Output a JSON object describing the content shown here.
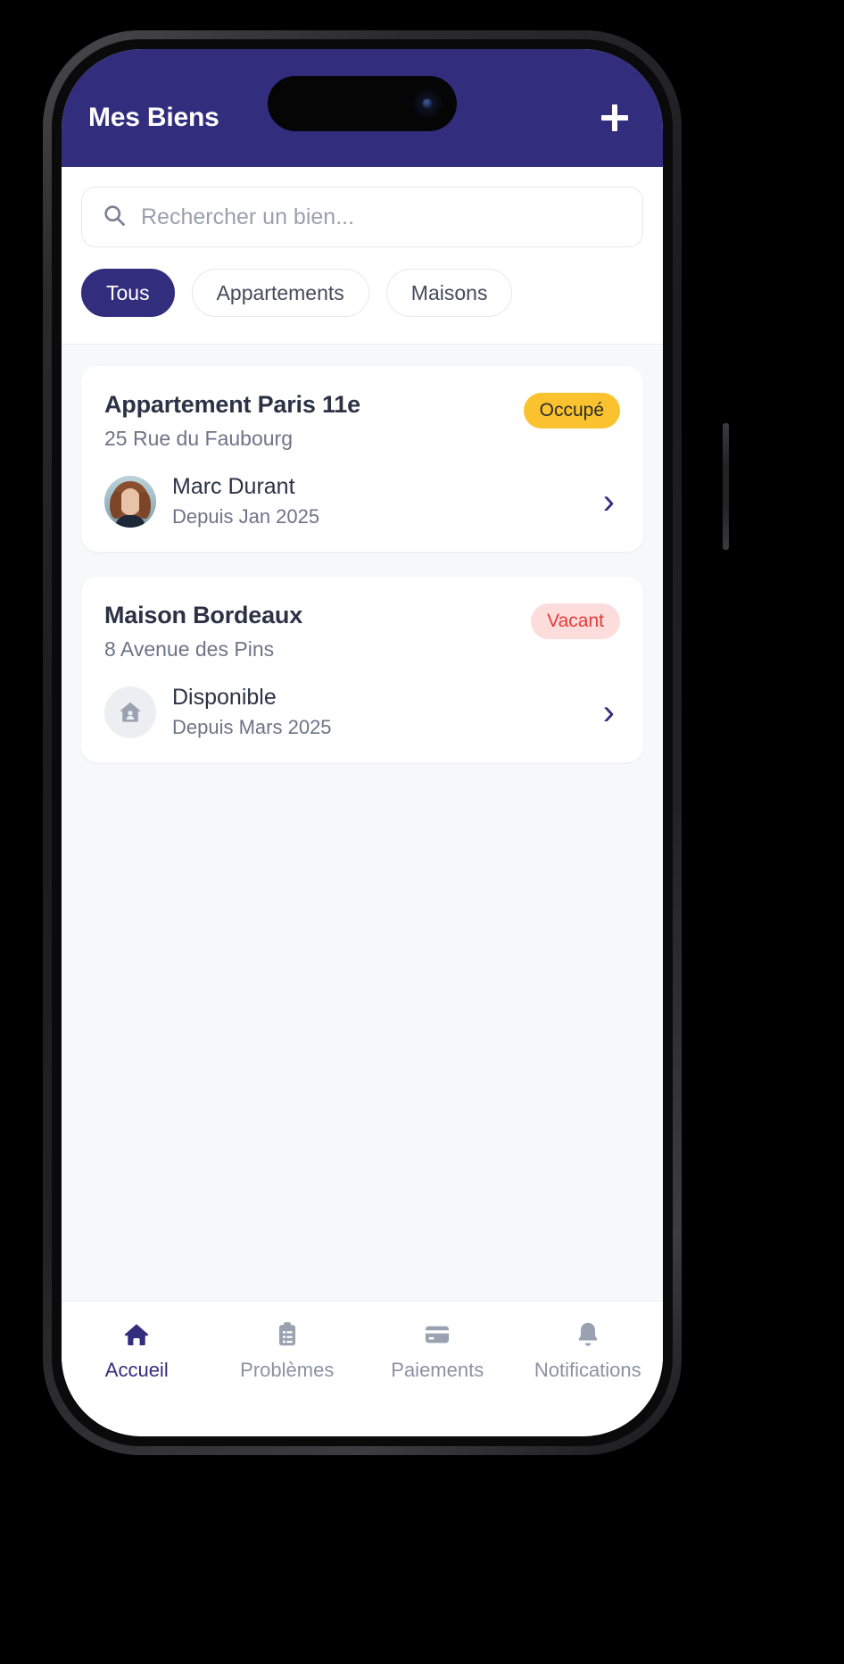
{
  "app": {
    "header": {
      "title": "Mes Biens",
      "add_button_label": "+",
      "add_icon": "plus-icon",
      "background_color": "#332D7E"
    },
    "search": {
      "icon": "search-icon",
      "placeholder": "Rechercher un bien...",
      "value": ""
    },
    "filters": [
      {
        "label": "Tous",
        "active": true
      },
      {
        "label": "Appartements",
        "active": false
      },
      {
        "label": "Maisons",
        "active": false
      }
    ],
    "properties": [
      {
        "title": "Appartement Paris 11e",
        "address": "25 Rue du Faubourg",
        "status": "Occupé",
        "status_type": "occupied",
        "status_bg": "#F9C22E",
        "status_color": "#2C2C2C",
        "tenant_name": "Marc Durant",
        "tenant_since": "Depuis Jan 2025",
        "avatar_type": "photo-avatar",
        "chevron": "›"
      },
      {
        "title": "Maison Bordeaux",
        "address": "8 Avenue des Pins",
        "status": "Vacant",
        "status_type": "vacant",
        "status_bg": "#FDDCDC",
        "status_color": "#E63A3A",
        "tenant_name": "Disponible",
        "tenant_since": "Depuis Mars 2025",
        "avatar_type": "house-icon",
        "chevron": "›"
      }
    ],
    "bottom_nav": [
      {
        "label": "Accueil",
        "icon": "home-icon",
        "active": true
      },
      {
        "label": "Problèmes",
        "icon": "clipboard-icon",
        "active": false
      },
      {
        "label": "Paiements",
        "icon": "credit-card-icon",
        "active": false
      },
      {
        "label": "Notifications",
        "icon": "bell-icon",
        "active": false
      }
    ],
    "theme": {
      "accent": "#332D7E",
      "page_bg": "#F7F8FA",
      "card_bg": "#FFFFFF",
      "muted_text": "#6D7486",
      "title_text": "#2C3245"
    }
  }
}
